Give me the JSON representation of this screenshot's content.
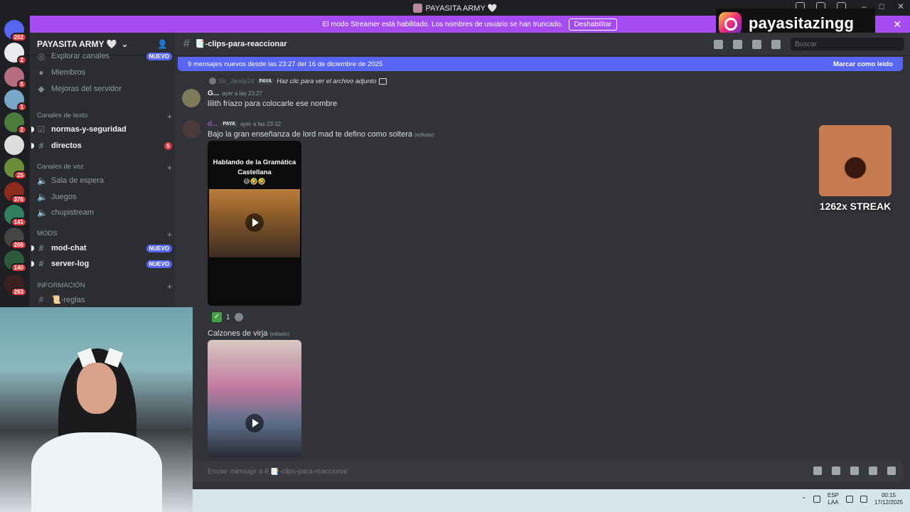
{
  "window": {
    "title": "PAYASITA ARMY 🤍"
  },
  "banner": {
    "text": "El modo Streamer está habilitado. Los nombres de usuario se han truncado.",
    "button": "Deshabilitar",
    "close": "✕"
  },
  "instagram": {
    "handle": "payasitazingg"
  },
  "rail_badges": [
    "202",
    "2",
    "5",
    "1",
    "2",
    "25",
    "376",
    "141",
    "206",
    "140",
    "283"
  ],
  "server": {
    "name": "PAYASITA ARMY 🤍",
    "chevron": "⌄"
  },
  "sidebar": {
    "top_items": [
      {
        "label": "Explorar canales",
        "badge": "NUEVO"
      },
      {
        "label": "Miembros"
      },
      {
        "label": "Mejoras del servidor"
      }
    ],
    "text_category": "Canales de texto",
    "text_channels": [
      {
        "label": "normas-y-seguridad"
      },
      {
        "label": "directos",
        "count": "5"
      }
    ],
    "voice_category": "Canales de voz",
    "voice_channels": [
      {
        "label": "Sala de espera"
      },
      {
        "label": "Juegos"
      },
      {
        "label": "chupistream"
      }
    ],
    "mods_category": "MODS",
    "mods_channels": [
      {
        "label": "mod-chat",
        "badge": "NUEVO"
      },
      {
        "label": "server-log",
        "badge": "NUEVO"
      }
    ],
    "info_category": "INFORMACIÓN",
    "info_channels": [
      {
        "label": "📜-reglas"
      }
    ]
  },
  "channel": {
    "name": "📑-clips-para-reaccionar"
  },
  "search": {
    "placeholder": "Buscar"
  },
  "newbar": {
    "text": "9 mensajes nuevos desde las 23:27 del 16 de diciembre de 2025",
    "mark": "Marcar como leído"
  },
  "messages": [
    {
      "reply_user": "Sc_Jandy24",
      "reply_tag": "PAYA",
      "reply_text": "Haz clic para ver el archivo adjunto",
      "user": "G...",
      "time": "ayer a las 23:27",
      "text": "lilith friazo para colocarle ese nombre"
    },
    {
      "user": "d...",
      "tag": "PAYA",
      "time": "ayer a las 23:32",
      "text": "Bajo la gran enseñanza  de lord mad te defino como soltera",
      "edited": "(editado)",
      "video_caption": "Hablando de la Gramática Castellana",
      "video_emojis": "😅🤣🤣",
      "reaction_count": "1",
      "text2": "Calzones de virja",
      "edited2": "(editado)"
    }
  ],
  "streak": {
    "label": "1262x STREAK"
  },
  "composer": {
    "placeholder": "Enviar mensaje a # 📑-clips-para-reaccionar"
  },
  "taskbar": {
    "lang1": "ESP",
    "lang2": "LAA",
    "time": "00:15",
    "date": "17/12/2025"
  }
}
